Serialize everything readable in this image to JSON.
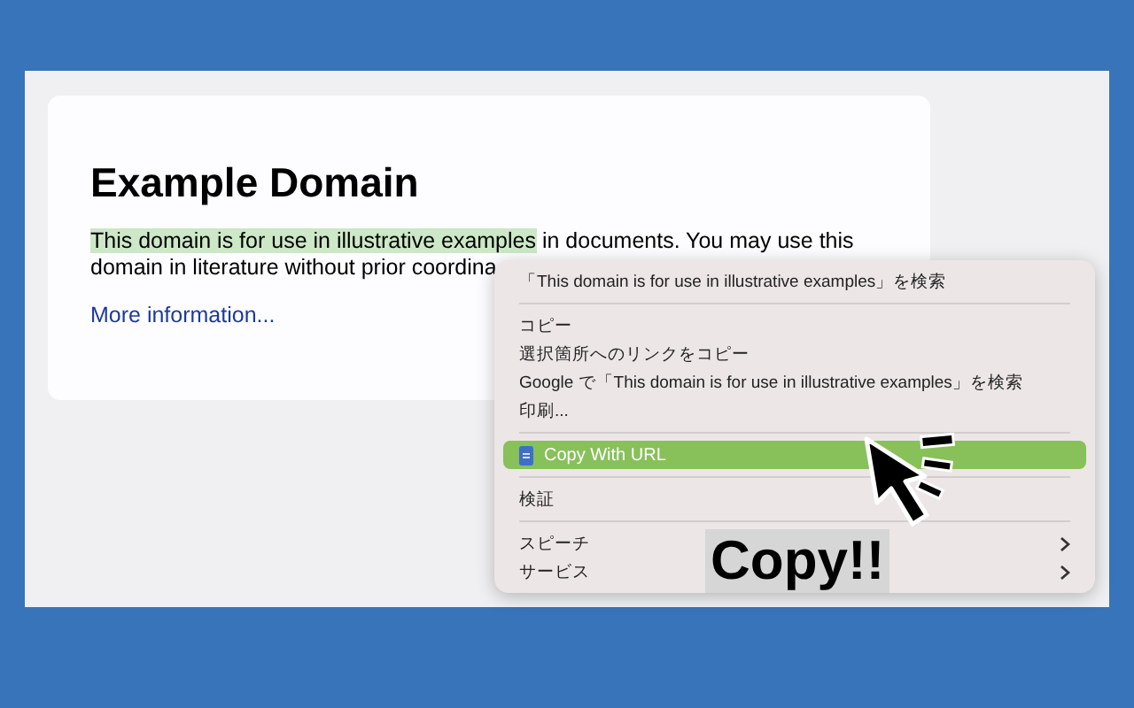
{
  "page": {
    "heading": "Example Domain",
    "lines": [
      {
        "selection": "This domain is for use in illustrative examples",
        "rest": " in documents. You may use this"
      },
      {
        "rest": "domain in literature without prior coordina"
      }
    ],
    "link": "More information..."
  },
  "context_menu": {
    "items": [
      {
        "kind": "item",
        "label": "「This domain is for use in illustrative examples」を検索",
        "selected": false,
        "submenu": false
      },
      {
        "kind": "separator"
      },
      {
        "kind": "item",
        "label": "コピー",
        "selected": false,
        "submenu": false
      },
      {
        "kind": "item",
        "label": "選択箇所へのリンクをコピー",
        "selected": false,
        "submenu": false
      },
      {
        "kind": "item",
        "label": "Google で「This domain is for use in illustrative examples」を検索",
        "selected": false,
        "submenu": false
      },
      {
        "kind": "item",
        "label": "印刷...",
        "selected": false,
        "submenu": false
      },
      {
        "kind": "separator"
      },
      {
        "kind": "extension",
        "label": "Copy With URL",
        "selected": true,
        "submenu": false
      },
      {
        "kind": "separator"
      },
      {
        "kind": "item",
        "label": "検証",
        "selected": false,
        "submenu": false
      },
      {
        "kind": "separator"
      },
      {
        "kind": "item",
        "label": "スピーチ",
        "selected": false,
        "submenu": true
      },
      {
        "kind": "item",
        "label": "サービス",
        "selected": false,
        "submenu": true
      }
    ]
  },
  "caption": "Copy!!"
}
